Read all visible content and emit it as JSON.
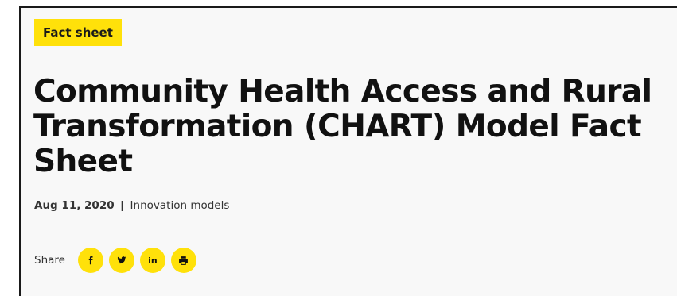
{
  "badge": {
    "label": "Fact sheet"
  },
  "header": {
    "title": "Community Health Access and Rural Transformation (CHART) Model Fact Sheet"
  },
  "meta": {
    "date": "Aug 11, 2020",
    "separator": "|",
    "category": "Innovation models"
  },
  "share": {
    "label": "Share",
    "buttons": [
      {
        "icon": "facebook-icon"
      },
      {
        "icon": "twitter-icon"
      },
      {
        "icon": "linkedin-icon",
        "text": "in"
      },
      {
        "icon": "print-icon"
      }
    ]
  },
  "colors": {
    "accent": "#ffe10a",
    "text": "#111111",
    "background": "#f8f8f8"
  }
}
